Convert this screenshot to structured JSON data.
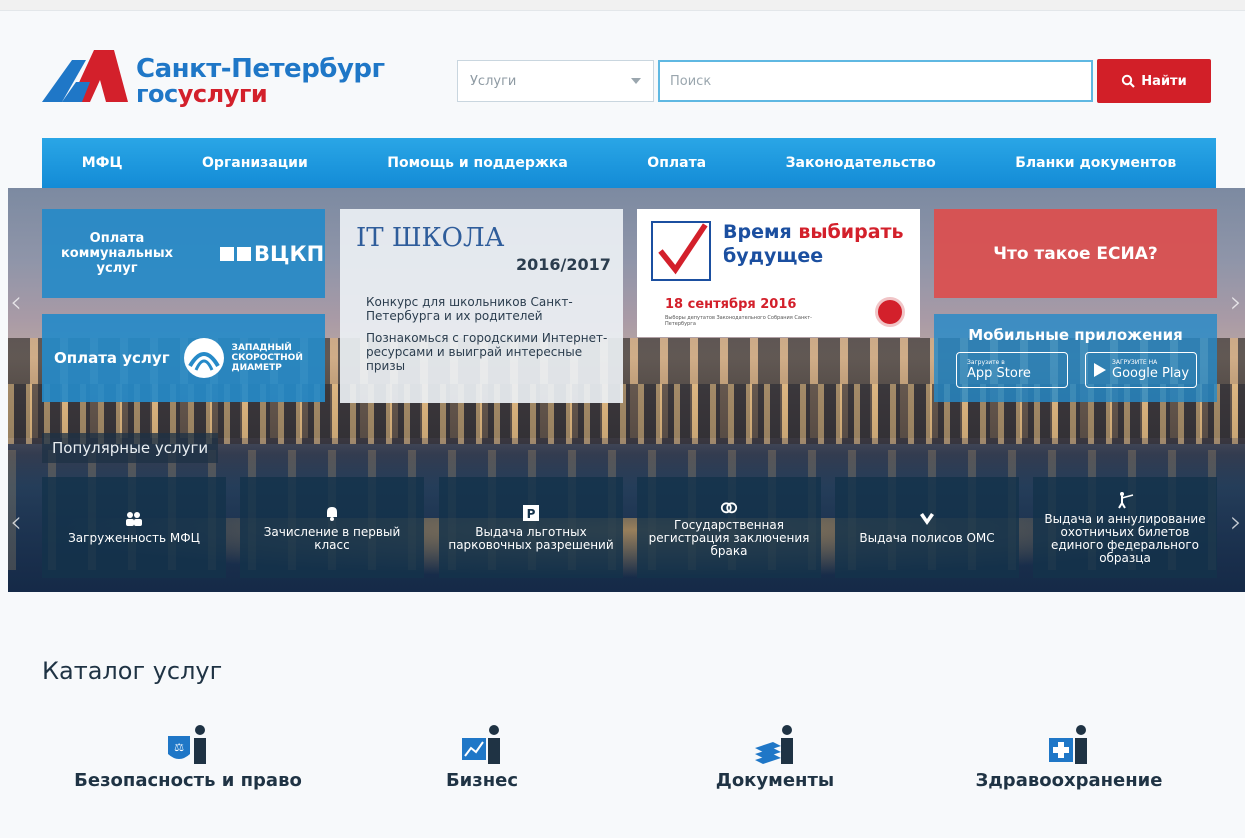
{
  "header": {
    "logo_city": "Санкт-Петербург",
    "logo_gos": "гос",
    "logo_uslugi": "услуги",
    "select_value": "Услуги",
    "search_placeholder": "Поиск",
    "search_button": "Найти"
  },
  "nav": [
    "МФЦ",
    "Организации",
    "Помощь и поддержка",
    "Оплата",
    "Законодательство",
    "Бланки документов"
  ],
  "banners": {
    "kommunal_label": "Оплата коммунальных услуг",
    "vckp_label": "ВЦКП",
    "pay_label": "Оплата услуг",
    "wsd_label": "ЗАПАДНЫЙ СКОРОСТНОЙ ДИАМЕТР",
    "it_logo": "IT ШКОЛА",
    "it_year": "2016/2017",
    "it_text1": "Конкурс для школьников Санкт-Петербурга и их родителей",
    "it_text2": "Познакомься с городскими Интернет-ресурсами и выиграй интересные призы",
    "vote_title_a": "Время ",
    "vote_title_b": "выбирать",
    "vote_title_c": "будущее",
    "vote_date": "18 сентября 2016",
    "vote_small": "Выборы депутатов Законодательного Собрания Санкт-Петербурга",
    "esia": "Что такое ЕСИА?",
    "mobile_title": "Мобильные приложения",
    "appstore_small": "Загрузите в",
    "appstore_big": "App Store",
    "googleplay_small": "ЗАГРУЗИТЕ НА",
    "googleplay_big": "Google Play"
  },
  "popular": {
    "title": "Популярные услуги",
    "items": [
      {
        "label": "Загруженность МФЦ",
        "icon": "people-icon"
      },
      {
        "label": "Зачисление в первый класс",
        "icon": "bell-icon"
      },
      {
        "label": "Выдача льготных парковочных разрешений",
        "icon": "parking-icon"
      },
      {
        "label": "Государственная регистрация заключения брака",
        "icon": "rings-icon"
      },
      {
        "label": "Выдача полисов ОМС",
        "icon": "hands-icon"
      },
      {
        "label": "Выдача и аннулирование охотничьих билетов единого федерального образца",
        "icon": "hunter-icon"
      }
    ]
  },
  "catalog": {
    "title": "Каталог услуг",
    "items": [
      {
        "label": "Безопасность и право",
        "icon": "scales-icon"
      },
      {
        "label": "Бизнес",
        "icon": "chart-icon"
      },
      {
        "label": "Документы",
        "icon": "documents-icon"
      },
      {
        "label": "Здравоохранение",
        "icon": "medical-icon"
      }
    ]
  },
  "colors": {
    "brand_blue": "#1f77c7",
    "brand_red": "#d3202b",
    "nav_blue": "#1d97df"
  }
}
